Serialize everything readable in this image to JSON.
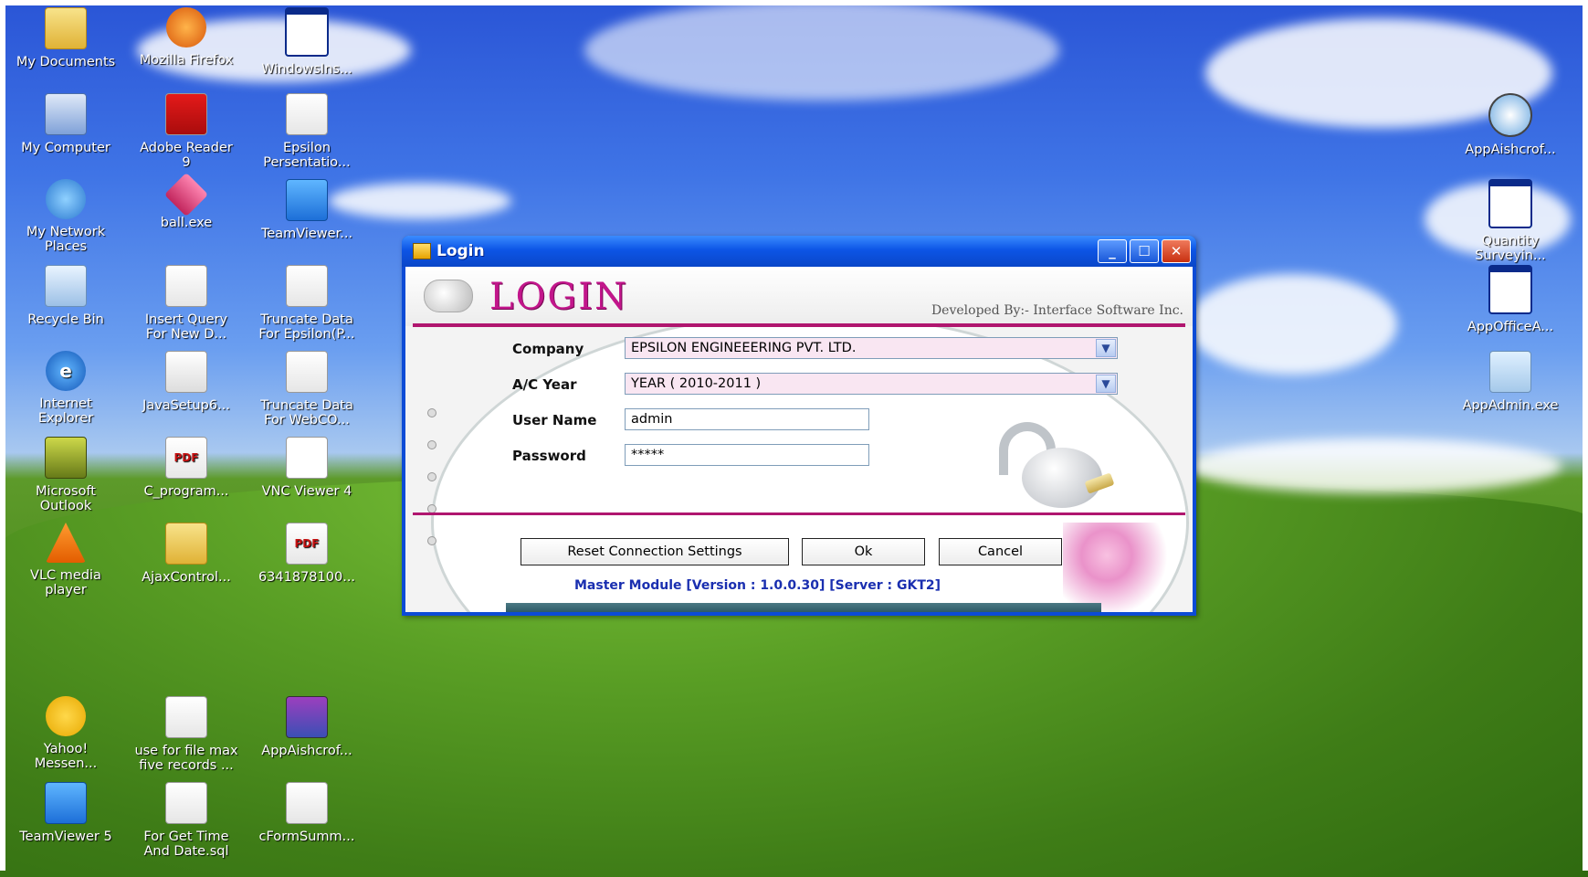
{
  "desktop": {
    "col1": [
      {
        "label": "My Documents"
      },
      {
        "label": "My Computer"
      },
      {
        "label": "My Network\nPlaces"
      },
      {
        "label": "Recycle Bin"
      },
      {
        "label": "Internet\nExplorer"
      },
      {
        "label": "Microsoft\nOutlook"
      },
      {
        "label": "VLC media\nplayer"
      },
      {
        "label": "Yahoo!\nMessen..."
      },
      {
        "label": "TeamViewer 5"
      }
    ],
    "col2": [
      {
        "label": "Mozilla Firefox"
      },
      {
        "label": "Adobe Reader\n9"
      },
      {
        "label": "ball.exe"
      },
      {
        "label": "Insert Query\nFor New D..."
      },
      {
        "label": "JavaSetup6..."
      },
      {
        "label": "C_program..."
      },
      {
        "label": "AjaxControl..."
      },
      {
        "label": "use for file max\nfive records ..."
      },
      {
        "label": "For Get Time\nAnd Date.sql"
      }
    ],
    "col3": [
      {
        "label": "WindowsIns..."
      },
      {
        "label": "Epsilon\nPersentatio..."
      },
      {
        "label": "TeamViewer..."
      },
      {
        "label": "Truncate Data\nFor Epsilon(P..."
      },
      {
        "label": "Truncate Data\nFor WebCO..."
      },
      {
        "label": "VNC Viewer 4"
      },
      {
        "label": "6341878100..."
      },
      {
        "label": "AppAishcrof..."
      },
      {
        "label": "cFormSumm..."
      }
    ],
    "right": [
      {
        "label": "AppAishcrof..."
      },
      {
        "label": "Quantity\nSurveyin..."
      },
      {
        "label": "AppOfficeA..."
      },
      {
        "label": "AppAdmin.exe"
      }
    ],
    "pdf_badge": "PDF"
  },
  "window": {
    "title": "Login",
    "logo": "LOGIN",
    "developed_by": "Developed By:- Interface Software Inc.",
    "company_label": "Company",
    "company_value": "EPSILON ENGINEEERING PVT. LTD.",
    "year_label": "A/C Year",
    "year_value": "YEAR ( 2010-2011 )",
    "username_label": "User Name",
    "username_value": "admin",
    "password_label": "Password",
    "password_value": "*****",
    "reset_button": "Reset Connection Settings",
    "ok_button": "Ok",
    "cancel_button": "Cancel",
    "version_text": "Master Module [Version : 1.0.0.30] [Server : GKT2]"
  }
}
